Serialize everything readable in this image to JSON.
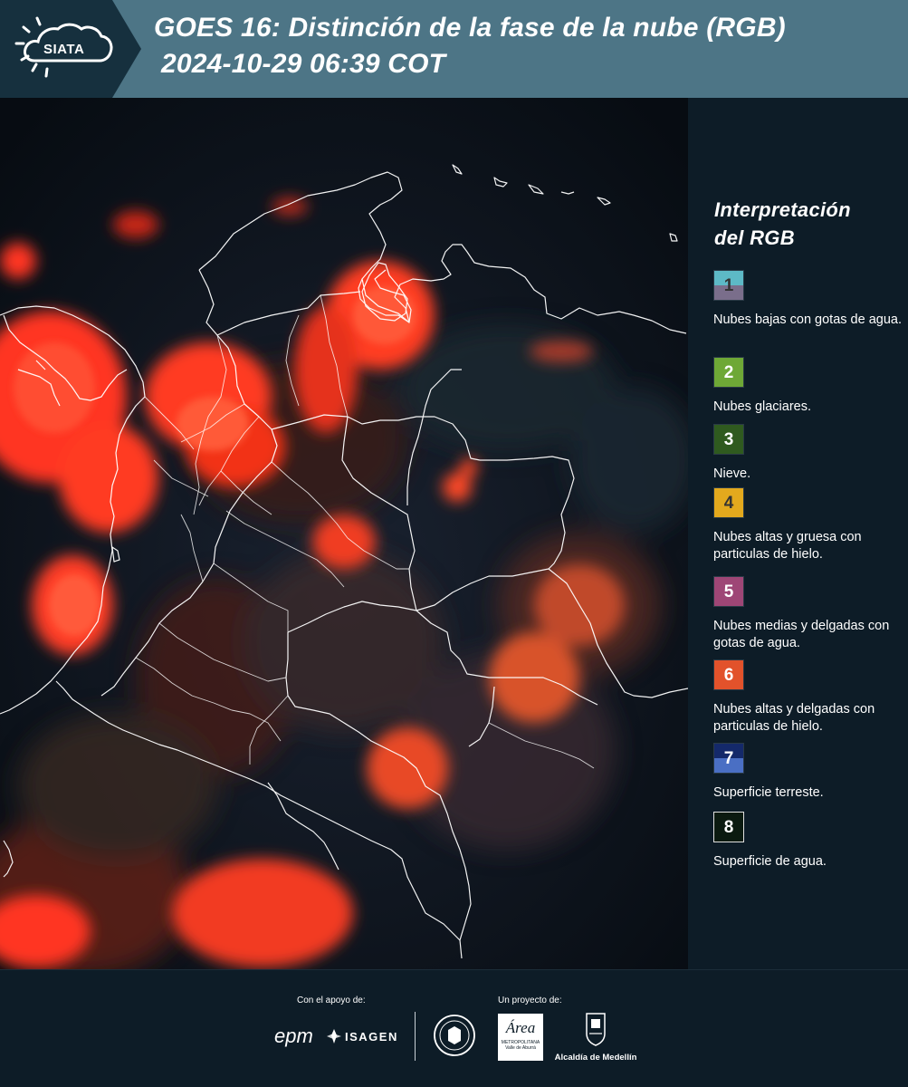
{
  "header": {
    "logo_text": "SIATA",
    "title_line1": "GOES 16: Distinción de la fase de la nube (RGB)",
    "title_line2": "2024-10-29 06:39 COT"
  },
  "legend": {
    "title_line1": "Interpretación",
    "title_line2": "del RGB",
    "items": [
      {
        "num": "1",
        "label": "Nubes bajas con gotas de agua.",
        "color_top": "#5db9c6",
        "color_bottom": "#7a6e8b",
        "num_color": "#333333"
      },
      {
        "num": "2",
        "label": "Nubes glaciares.",
        "color_top": "#6ea836",
        "color_bottom": "#6ea836",
        "num_color": "#ffffff"
      },
      {
        "num": "3",
        "label": "Nieve.",
        "color_top": "#2f5a1f",
        "color_bottom": "#2f5a1f",
        "num_color": "#ffffff"
      },
      {
        "num": "4",
        "label": "Nubes altas y gruesa con particulas de hielo.",
        "color_top": "#e3a91d",
        "color_bottom": "#e3a91d",
        "num_color": "#333333"
      },
      {
        "num": "5",
        "label": "Nubes medias y delgadas con gotas de agua.",
        "color_top": "#9e4676",
        "color_bottom": "#9e4676",
        "num_color": "#ffffff"
      },
      {
        "num": "6",
        "label": "Nubes altas y delgadas con particulas de hielo.",
        "color_top": "#e2522b",
        "color_bottom": "#e2522b",
        "num_color": "#ffffff"
      },
      {
        "num": "7",
        "label": "Superficie terreste.",
        "color_top": "#14296a",
        "color_bottom": "#4a6fc4",
        "num_color": "#ffffff"
      },
      {
        "num": "8",
        "label": "Superficie de agua.",
        "color_top": "#0b1a10",
        "color_bottom": "#0b1a10",
        "num_color": "#ffffff"
      }
    ]
  },
  "footer": {
    "support_label": "Con el apoyo de:",
    "project_label": "Un proyecto de:",
    "sponsor_epm": "epm",
    "sponsor_isagen": "ISAGEN",
    "sponsor_area_title": "Área",
    "sponsor_area_sub1": "METROPOLITANA",
    "sponsor_area_sub2": "Valle de Aburrá",
    "sponsor_alcaldia": "Alcaldía de Medellín"
  },
  "colors": {
    "header_bg": "#4d7586",
    "panel_bg": "#0d1c27",
    "cloud_red": "#ff3a1f",
    "border_white": "#ffffff"
  }
}
